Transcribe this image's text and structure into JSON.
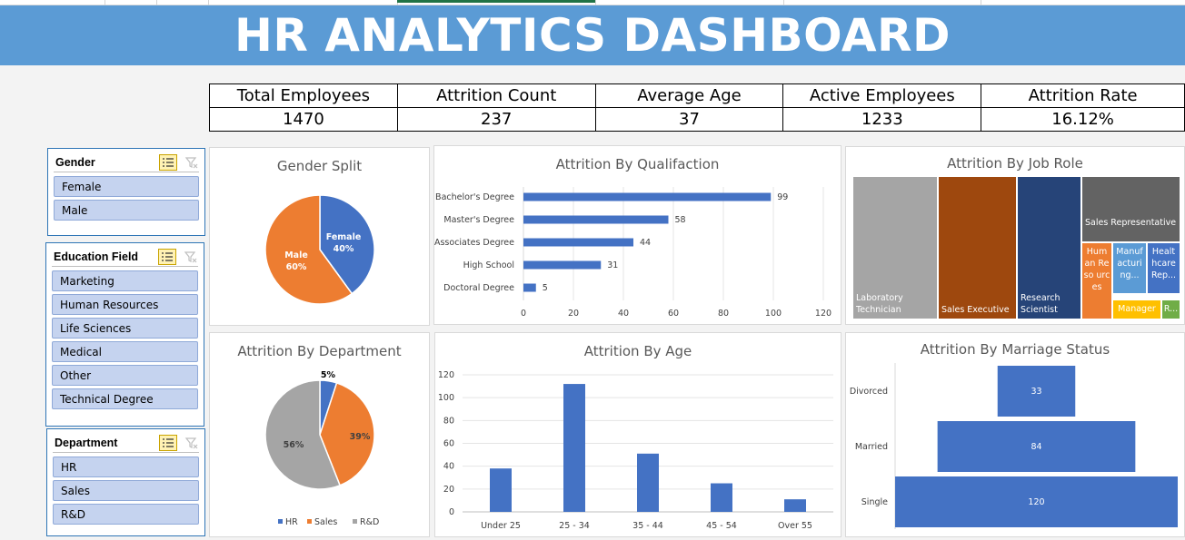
{
  "dashboard_title": "HR ANALYTICS DASHBOARD",
  "kpis": [
    {
      "label": "Total Employees",
      "value": "1470"
    },
    {
      "label": "Attrition Count",
      "value": "237"
    },
    {
      "label": "Average Age",
      "value": "37"
    },
    {
      "label": "Active Employees",
      "value": "1233"
    },
    {
      "label": "Attrition Rate",
      "value": "16.12%"
    }
  ],
  "slicers": {
    "gender": {
      "title": "Gender",
      "items": [
        "Female",
        "Male"
      ]
    },
    "education": {
      "title": "Education Field",
      "items": [
        "Marketing",
        "Human Resources",
        "Life Sciences",
        "Medical",
        "Other",
        "Technical Degree"
      ]
    },
    "department": {
      "title": "Department",
      "items": [
        "HR",
        "Sales",
        "R&D"
      ]
    }
  },
  "colors": {
    "banner": "#5b9bd5",
    "blue": "#4472c4",
    "orange": "#ed7d31",
    "gray": "#a5a5a5",
    "brown": "#9e480e",
    "navy": "#264478",
    "darkgray": "#636363",
    "yellow": "#ffc000",
    "green": "#70ad47",
    "lightblue": "#5b9bd5"
  },
  "chart_data": [
    {
      "id": "gender",
      "type": "pie",
      "title": "Gender Split",
      "categories": [
        "Female",
        "Male"
      ],
      "values": [
        40,
        60
      ],
      "labels": [
        "40%",
        "60%"
      ]
    },
    {
      "id": "qualification",
      "type": "bar",
      "orientation": "horizontal",
      "title": "Attrition By Qualifaction",
      "categories": [
        "Bachelor's Degree",
        "Master's Degree",
        "Associates Degree",
        "High School",
        "Doctoral Degree"
      ],
      "values": [
        99,
        58,
        44,
        31,
        5
      ],
      "xlim": [
        0,
        120
      ],
      "xticks": [
        0,
        20,
        40,
        60,
        80,
        100,
        120
      ],
      "grid": true
    },
    {
      "id": "jobrole",
      "type": "treemap",
      "title": "Attrition By Job Role",
      "categories": [
        "Laboratory Technician",
        "Sales Executive",
        "Research Scientist",
        "Sales Representative",
        "Human Resources",
        "Manufacturing...",
        "Healthcare Rep...",
        "Manager",
        "R..."
      ],
      "tile_labels": [
        "Laboratory Technician",
        "Sales Executive",
        "Research Scientist",
        "Sales Representative",
        "Hum an Reso urces",
        "Manuf acturi ng...",
        "Healt hcare Rep...",
        "Manager",
        "R..."
      ],
      "values": [
        62,
        57,
        47,
        33,
        12,
        10,
        9,
        5,
        2
      ]
    },
    {
      "id": "department",
      "type": "pie",
      "title": "Attrition By Department",
      "categories": [
        "HR",
        "Sales",
        "R&D"
      ],
      "values": [
        5,
        39,
        56
      ],
      "labels": [
        "5%",
        "39%",
        "56%"
      ],
      "legend": "bottom"
    },
    {
      "id": "age",
      "type": "bar",
      "orientation": "vertical",
      "title": "Attrition By Age",
      "categories": [
        "Under 25",
        "25 - 34",
        "35 - 44",
        "45 - 54",
        "Over 55"
      ],
      "values": [
        38,
        112,
        51,
        25,
        11
      ],
      "ylim": [
        0,
        120
      ],
      "yticks": [
        0,
        20,
        40,
        60,
        80,
        100,
        120
      ],
      "grid": true
    },
    {
      "id": "marriage",
      "type": "bar",
      "orientation": "horizontal-centered",
      "title": "Attrition By Marriage Status",
      "categories": [
        "Divorced",
        "Married",
        "Single"
      ],
      "values": [
        33,
        84,
        120
      ]
    }
  ]
}
